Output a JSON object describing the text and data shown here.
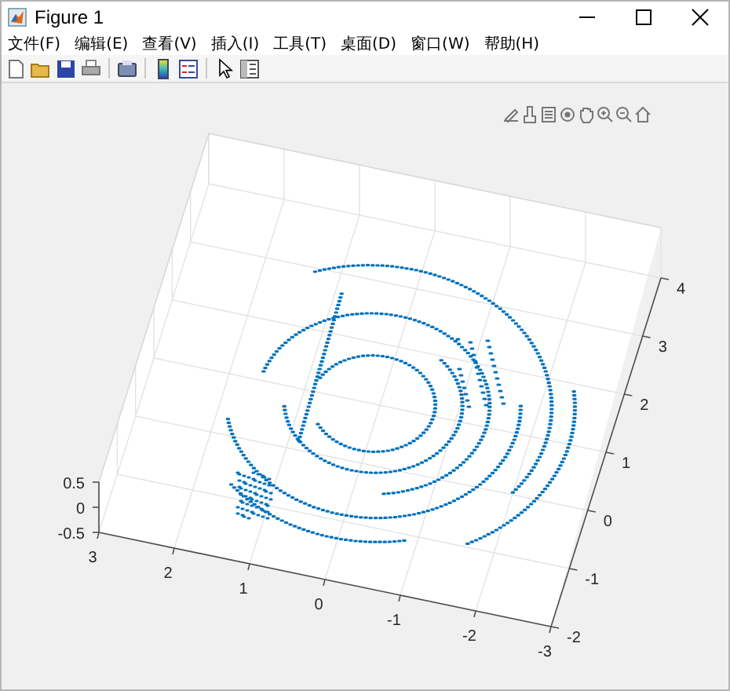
{
  "window": {
    "title": "Figure 1"
  },
  "menu": [
    "文件(F)",
    "编辑(E)",
    "查看(V)",
    "插入(I)",
    "工具(T)",
    "桌面(D)",
    "窗口(W)",
    "帮助(H)"
  ],
  "plot": {
    "x_ticks": [
      "3",
      "2",
      "1",
      "0",
      "-1",
      "-2",
      "-3"
    ],
    "y_ticks": [
      "4",
      "3",
      "2",
      "1",
      "0",
      "-1",
      "-2"
    ],
    "z_ticks": [
      "0.5",
      "0",
      "-0.5"
    ]
  }
}
